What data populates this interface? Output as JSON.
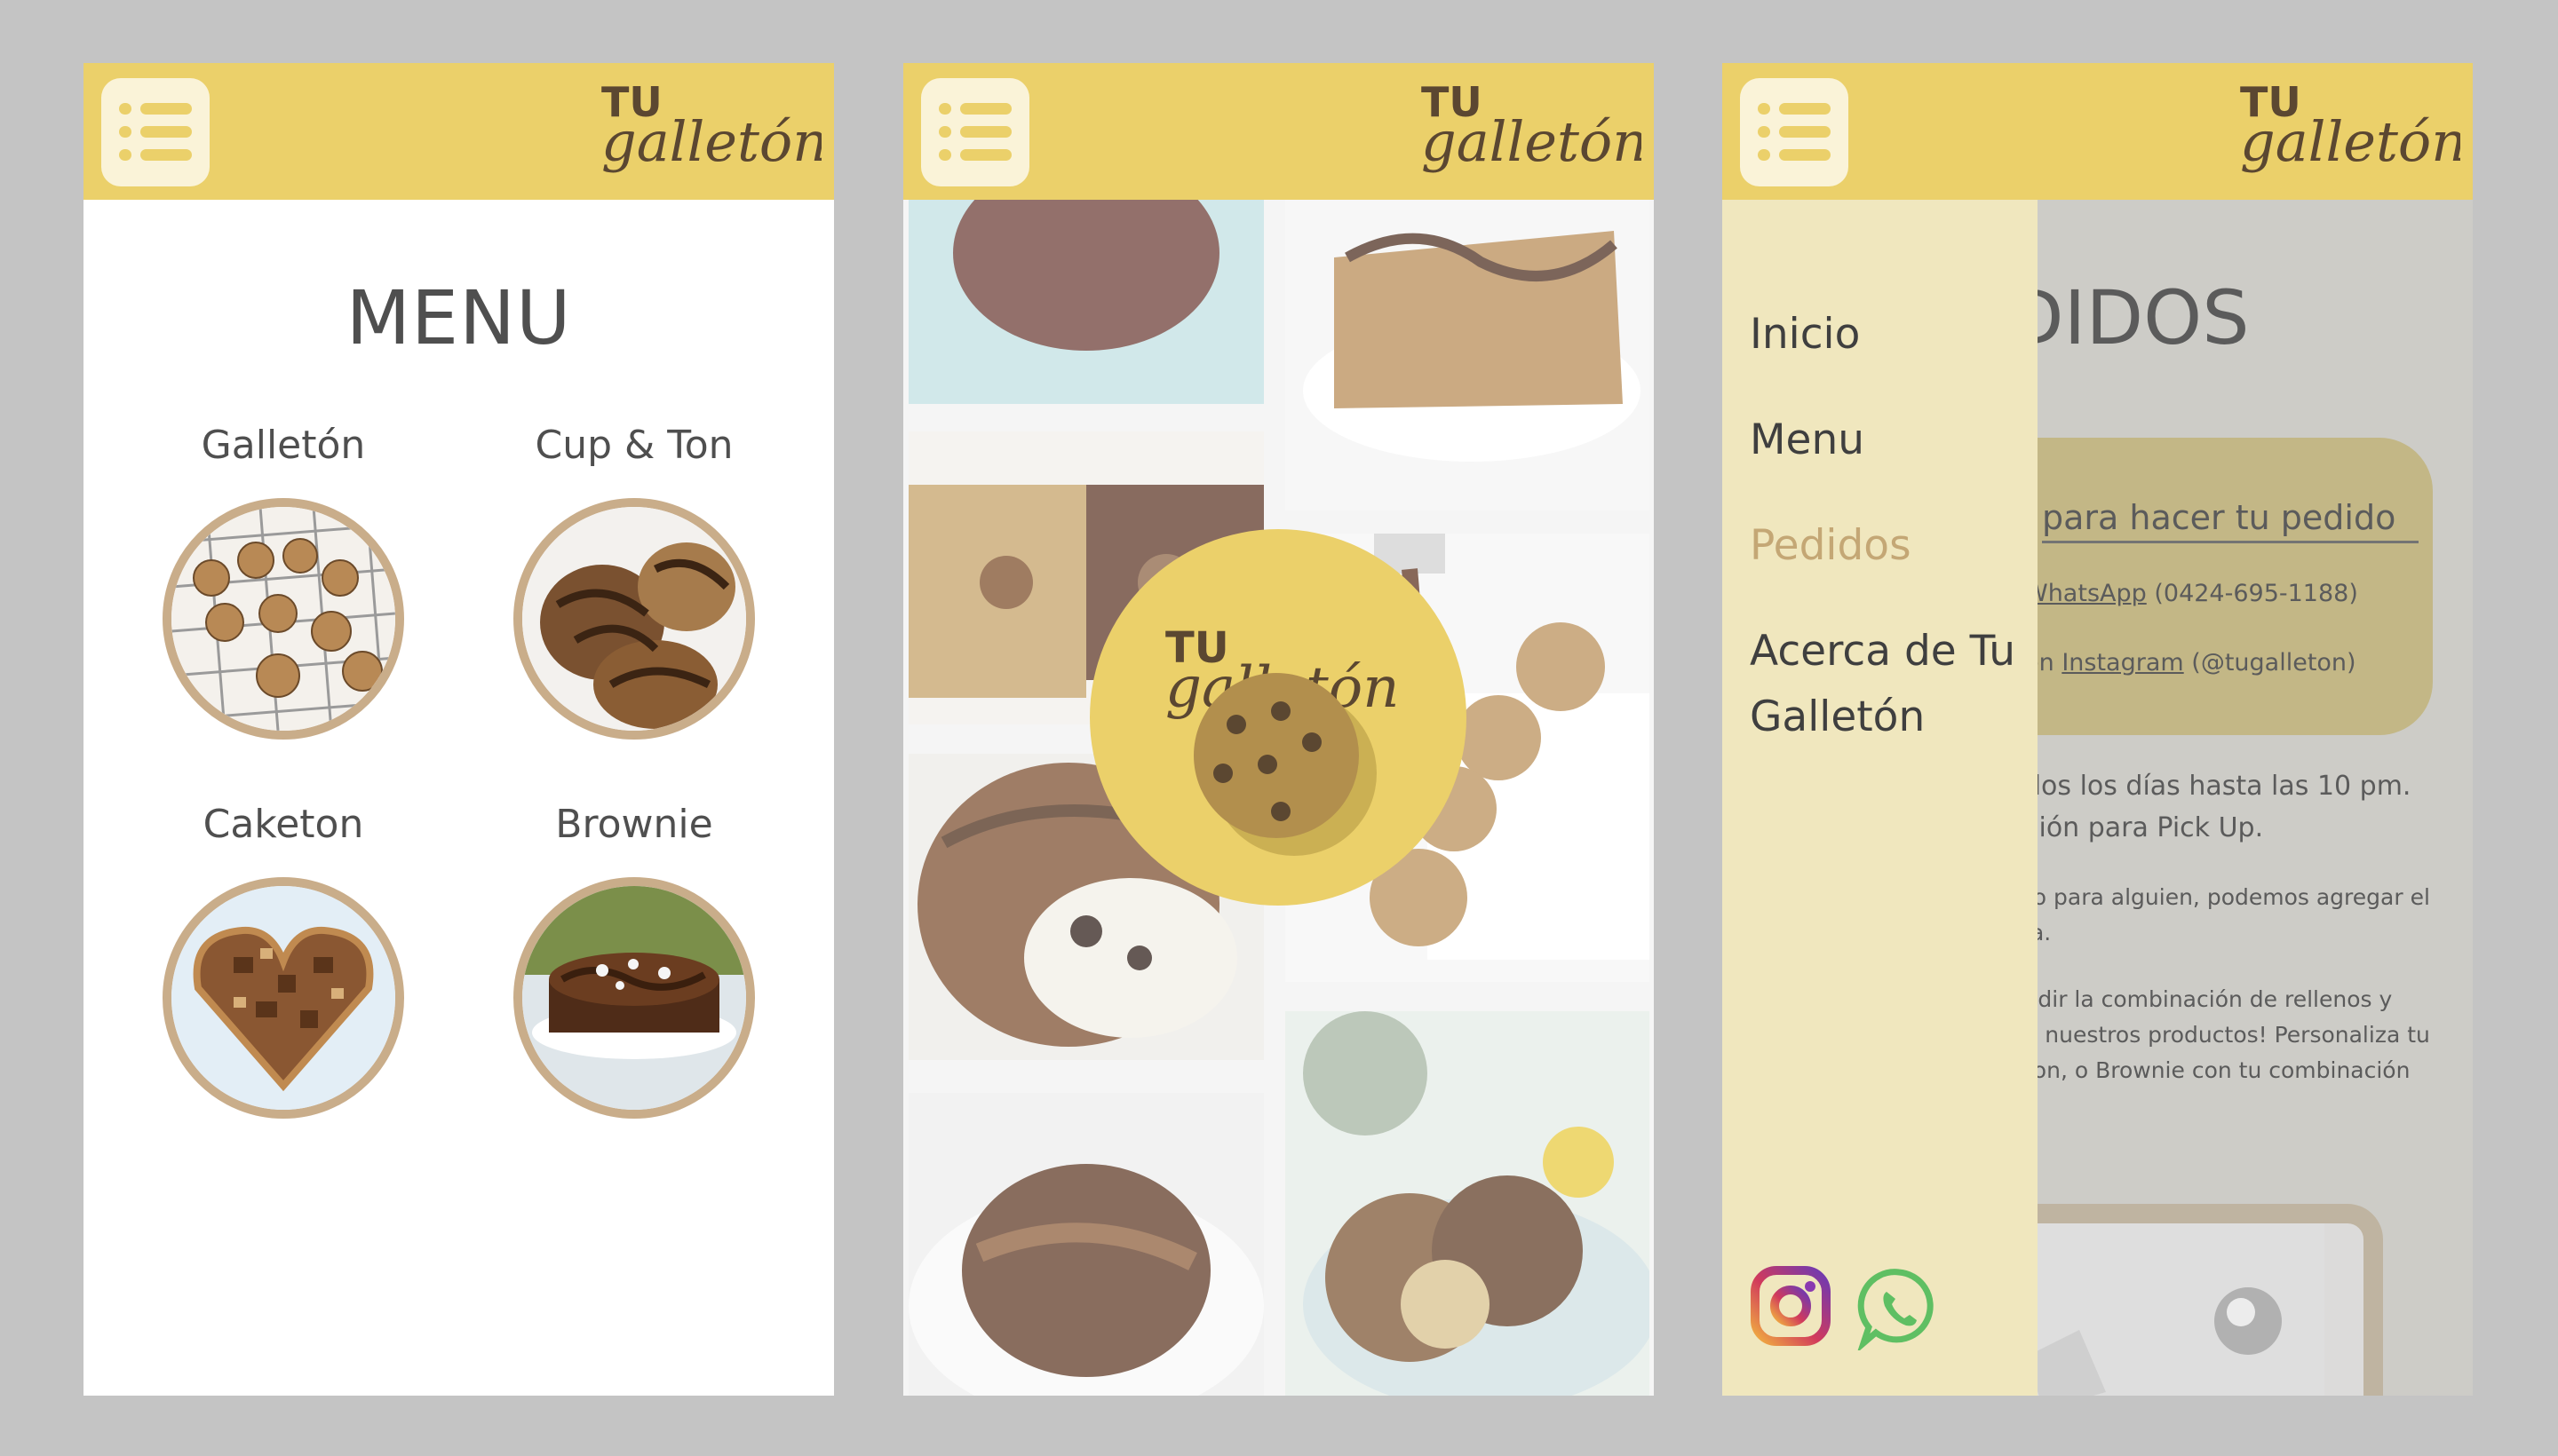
{
  "brand": {
    "logo_small": "TU",
    "logo_script": "galletón",
    "colors": {
      "header": "#ebd06a",
      "menu_button": "#faf3d8",
      "photo_ring": "#c9ad8a",
      "drawer": "#f0e7be",
      "active_link": "#c4a775",
      "text": "#4f4f4f"
    }
  },
  "menu_page": {
    "title": "MENU",
    "items": [
      {
        "label": "Galletón",
        "image": "cookies-on-rack"
      },
      {
        "label": "Cup & Ton",
        "image": "chocolate-cups"
      },
      {
        "label": "Caketon",
        "image": "heart-cake"
      },
      {
        "label": "Brownie",
        "image": "round-brownie"
      }
    ]
  },
  "gallery_page": {
    "tiles": [
      "chocolate-cookie",
      "cookie-bar",
      "cookie-halves",
      "chocolate-pour",
      "oreo-brownie",
      "chocolate-cup",
      "marble-cookies"
    ]
  },
  "pedidos_page": {
    "nav": {
      "items": [
        "Inicio",
        "Menu",
        "Pedidos",
        "Acerca de Tu Galletón"
      ],
      "active": "Pedidos"
    },
    "title": "DIDOS",
    "order_heading": "para hacer tu pedido",
    "whatsapp_line": {
      "link": "WhatsApp",
      "text": "(0424-695-1188)"
    },
    "instagram_line": {
      "prefix": "en",
      "link": "Instagram",
      "text": "(@tugalleton)"
    },
    "paragraphs": [
      "dos los días hasta las 10 pm.",
      "ción para Pick Up.",
      "to para alguien, podemos agregar el",
      "ia.",
      "edir la combinación de rellenos y",
      "a nuestros productos! Personaliza tu",
      "ton, o Brownie con tu combinación"
    ],
    "social_icons": [
      "instagram-icon",
      "whatsapp-icon"
    ]
  }
}
